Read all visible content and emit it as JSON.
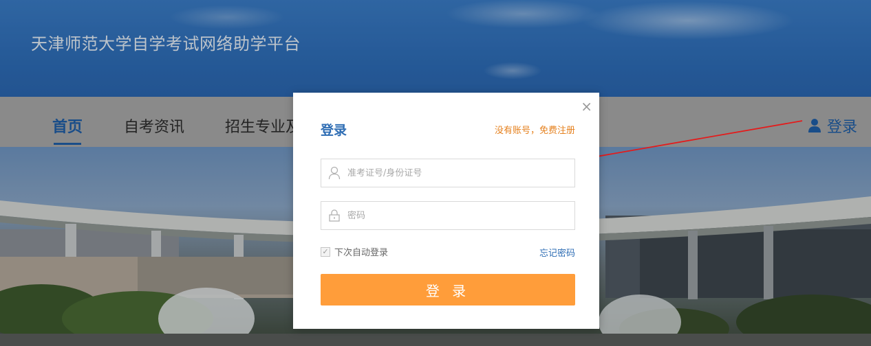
{
  "header": {
    "site_title": "天津师范大学自学考试网络助学平台"
  },
  "nav": {
    "items": [
      {
        "label": "首页",
        "active": true
      },
      {
        "label": "自考资讯",
        "active": false
      },
      {
        "label": "招生专业及",
        "active": false
      }
    ],
    "login_label": "登录",
    "login_icon": "user-icon"
  },
  "modal": {
    "title": "登录",
    "register_link": "没有账号，免费注册",
    "close_icon": "close-icon",
    "username": {
      "placeholder": "准考证号/身份证号",
      "value": "",
      "icon": "user-outline-icon"
    },
    "password": {
      "placeholder": "密码",
      "value": "",
      "icon": "lock-icon"
    },
    "remember_label": "下次自动登录",
    "remember_checked": true,
    "forgot_link": "忘记密码",
    "submit_label": "登 录"
  },
  "colors": {
    "brand_blue": "#2e6db4",
    "button_orange": "#ff9d3a",
    "register_orange": "#e5801d",
    "annotation_red": "#e41b1b"
  }
}
